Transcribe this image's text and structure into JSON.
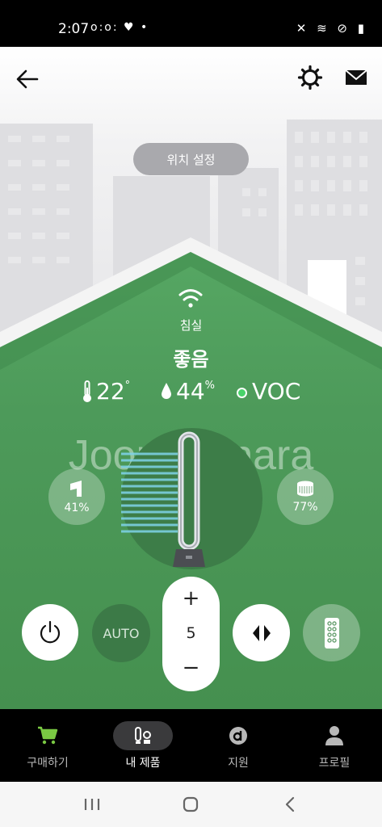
{
  "status_bar": {
    "time": "2:07",
    "notification_icons": "ᴏ:ᴏ: ♥ •",
    "system_icons": "✕ ≋ ⊘ ▮"
  },
  "header": {
    "back_icon": "back-arrow-icon",
    "settings_icon": "gear-icon",
    "mail_icon": "mail-icon"
  },
  "location_button": {
    "label": "위치 설정"
  },
  "room": {
    "name": "침실",
    "status": "좋음",
    "temperature": "22",
    "temperature_unit": "°",
    "humidity": "44",
    "humidity_unit": "%",
    "voc_label": "VOC"
  },
  "watermark": "Joonggonara",
  "filters": {
    "left_value": "41%",
    "right_value": "77%"
  },
  "controls": {
    "auto_label": "AUTO",
    "speed_plus": "+",
    "speed_value": "5",
    "speed_minus": "−"
  },
  "bottom_nav": {
    "items": [
      {
        "label": "구매하기",
        "icon": "cart-icon"
      },
      {
        "label": "내 제품",
        "icon": "my-products-icon"
      },
      {
        "label": "지원",
        "icon": "support-icon"
      },
      {
        "label": "프로필",
        "icon": "profile-icon"
      }
    ],
    "active_index": 1
  },
  "colors": {
    "accent_green": "#48d36a",
    "house_green": "#4f9a5c",
    "cart_green": "#7ac943"
  }
}
